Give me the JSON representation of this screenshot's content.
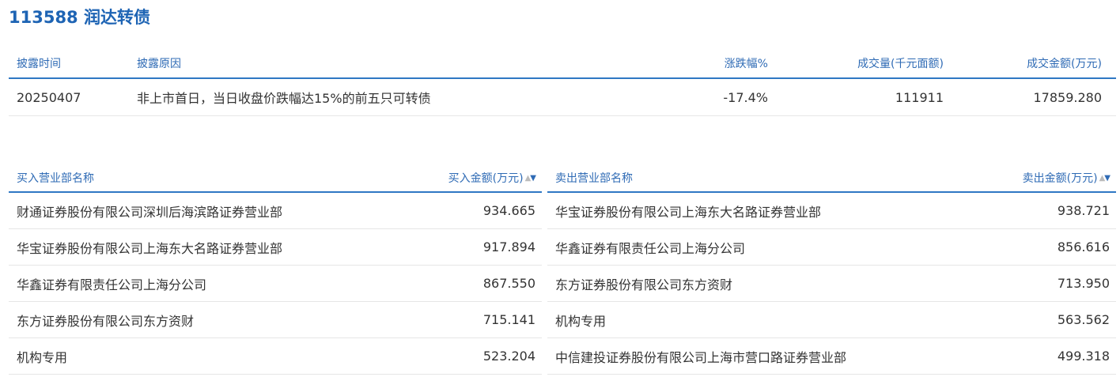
{
  "header": {
    "title": "113588 润达转债"
  },
  "disclosure": {
    "columns": [
      "披露时间",
      "披露原因",
      "涨跌幅%",
      "成交量(千元面额)",
      "成交金额(万元)"
    ],
    "rows": [
      [
        "20250407",
        "非上市首日，当日收盘价跌幅达15%的前五只可转债",
        "-17.4%",
        "111911",
        "17859.280"
      ]
    ]
  },
  "buy": {
    "name_header": "买入营业部名称",
    "amount_header": "买入金额(万元)",
    "sort_up_icon": "▲",
    "sort_down_icon": "▼",
    "rows": [
      {
        "name": "财通证券股份有限公司深圳后海滨路证券营业部",
        "amount": "934.665"
      },
      {
        "name": "华宝证券股份有限公司上海东大名路证券营业部",
        "amount": "917.894"
      },
      {
        "name": "华鑫证券有限责任公司上海分公司",
        "amount": "867.550"
      },
      {
        "name": "东方证券股份有限公司东方资财",
        "amount": "715.141"
      },
      {
        "name": "机构专用",
        "amount": "523.204"
      }
    ]
  },
  "sell": {
    "name_header": "卖出营业部名称",
    "amount_header": "卖出金额(万元)",
    "sort_up_icon": "▲",
    "sort_down_icon": "▼",
    "rows": [
      {
        "name": "华宝证券股份有限公司上海东大名路证券营业部",
        "amount": "938.721"
      },
      {
        "name": "华鑫证券有限责任公司上海分公司",
        "amount": "856.616"
      },
      {
        "name": "东方证券股份有限公司东方资财",
        "amount": "713.950"
      },
      {
        "name": "机构专用",
        "amount": "563.562"
      },
      {
        "name": "中信建投证券股份有限公司上海市营口路证券营业部",
        "amount": "499.318"
      }
    ]
  },
  "colors": {
    "accent": "#2f78c4",
    "title": "#1e64b4",
    "text": "#333333",
    "divider": "#e6e6e6"
  }
}
